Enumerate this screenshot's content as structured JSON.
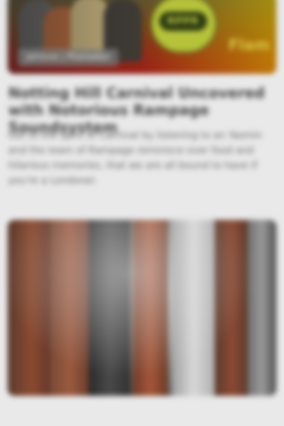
{
  "feed": {
    "card1": {
      "tag": "Jahlove | Promoted",
      "logo_text": "RPPR",
      "brand_text": "Flam",
      "headline": "Notting Hill Carnival Uncovered with Notorious Rampage Soundsystem",
      "summary": "Get to the spirit of Carnival by listening to an Yasmin and the team of Rampage reminisce over food and hilarious memories, that we are all bound to have if you're a Londoner."
    },
    "card2": {
      "image_subject": "redwood-forest-photo"
    }
  }
}
